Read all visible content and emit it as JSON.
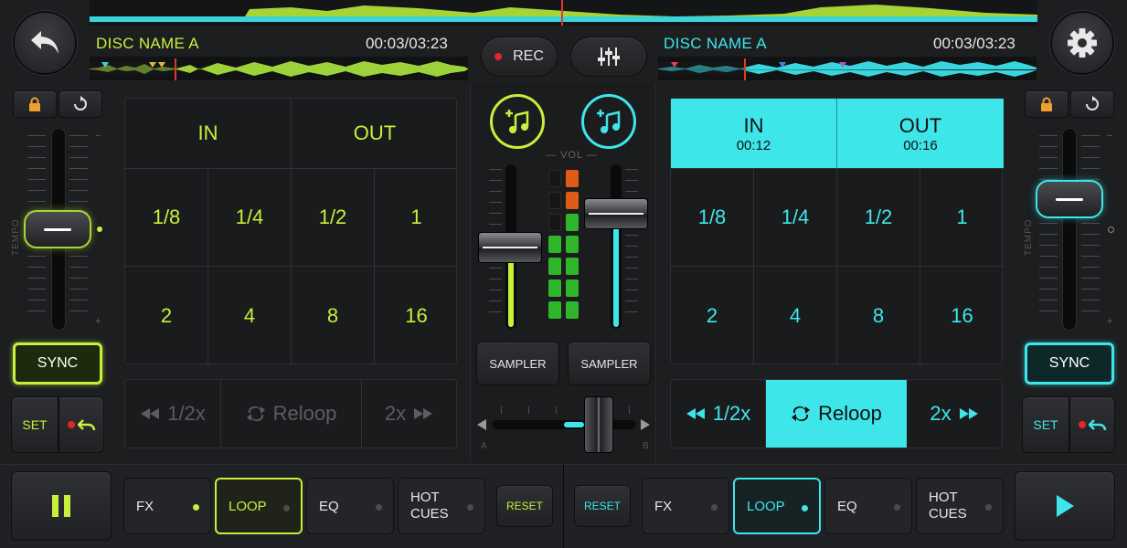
{
  "app": {
    "accent_left": "#c6f03c",
    "accent_right": "#3ee6ea"
  },
  "header": {
    "rec_label": "REC",
    "left_deck": {
      "disc_name": "DISC NAME A",
      "time": "00:03/03:23"
    },
    "right_deck": {
      "disc_name": "DISC NAME A",
      "time": "00:03/03:23"
    }
  },
  "mixer": {
    "vol_label": "VOL",
    "sampler_left": "SAMPLER",
    "sampler_right": "SAMPLER",
    "crossfader_a": "A",
    "crossfader_b": "B"
  },
  "left": {
    "tempo_label": "TEMPO",
    "tick_minus": "−",
    "tick_plus": "+",
    "sync_label": "SYNC",
    "set_label": "SET",
    "loop_in": "IN",
    "loop_out": "OUT",
    "grid": [
      "1/8",
      "1/4",
      "1/2",
      "1",
      "2",
      "4",
      "8",
      "16"
    ],
    "half_label": "1/2x",
    "reloop_label": "Reloop",
    "double_label": "2x"
  },
  "right": {
    "tempo_label": "TEMPO",
    "tick_minus": "−",
    "tick_plus": "+",
    "sync_label": "SYNC",
    "set_label": "SET",
    "loop_in": "IN",
    "loop_in_time": "00:12",
    "loop_out": "OUT",
    "loop_out_time": "00:16",
    "grid": [
      "1/8",
      "1/4",
      "1/2",
      "1",
      "2",
      "4",
      "8",
      "16"
    ],
    "half_label": "1/2x",
    "reloop_label": "Reloop",
    "double_label": "2x"
  },
  "bottom": {
    "left_tabs": {
      "fx": "FX",
      "loop": "LOOP",
      "eq": "EQ",
      "hot1": "HOT",
      "hot2": "CUES",
      "reset": "RESET"
    },
    "right_tabs": {
      "reset": "RESET",
      "fx": "FX",
      "loop": "LOOP",
      "eq": "EQ",
      "hot1": "HOT",
      "hot2": "CUES"
    }
  }
}
